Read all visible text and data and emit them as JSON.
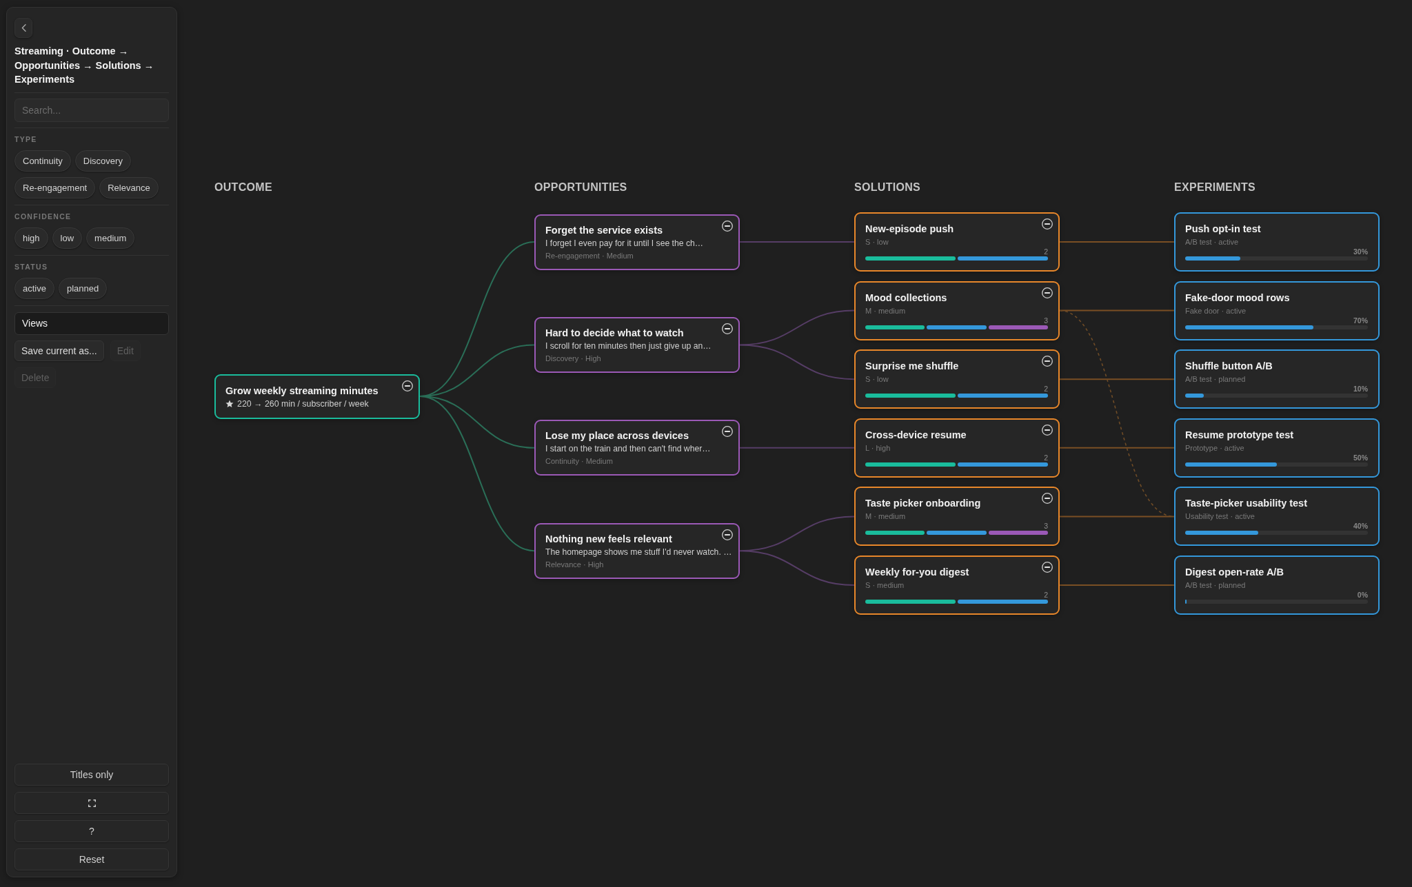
{
  "sidebar": {
    "title": "Streaming · Outcome → Opportunities → Solutions → Experiments",
    "search": {
      "placeholder": "Search..."
    },
    "filter_groups": [
      {
        "label": "TYPE",
        "chips": [
          {
            "label": "Continuity",
            "selected": false
          },
          {
            "label": "Discovery",
            "selected": false
          },
          {
            "label": "Re-engagement",
            "selected": false
          },
          {
            "label": "Relevance",
            "selected": false
          }
        ]
      },
      {
        "label": "CONFIDENCE",
        "chips": [
          {
            "label": "high",
            "selected": false
          },
          {
            "label": "low",
            "selected": false
          },
          {
            "label": "medium",
            "selected": false
          }
        ]
      },
      {
        "label": "STATUS",
        "chips": [
          {
            "label": "active",
            "selected": false
          },
          {
            "label": "planned",
            "selected": false
          }
        ]
      }
    ],
    "views": {
      "label": "Views"
    },
    "view_actions": [
      {
        "label": "Save current as...",
        "disabled": false
      },
      {
        "label": "Edit",
        "disabled": true
      },
      {
        "label": "Delete",
        "disabled": true
      }
    ],
    "bottom_buttons": [
      {
        "kind": "text",
        "label": "Titles only"
      },
      {
        "kind": "icon"
      },
      {
        "kind": "text",
        "label": "?"
      },
      {
        "kind": "text",
        "label": "Reset"
      }
    ]
  },
  "board": {
    "columns": [
      {
        "label": "OUTCOME"
      },
      {
        "label": "OPPORTUNITIES"
      },
      {
        "label": "SOLUTIONS"
      },
      {
        "label": "EXPERIMENTS"
      }
    ],
    "outcome": {
      "title": "Grow weekly streaming minutes",
      "metric": "220 → 260 min / subscriber / week",
      "expanded": true,
      "opportunities": [
        {
          "title": "Forget the service exists",
          "description": "I forget I even pay for it until I see the ch…",
          "meta": "Re-engagement · Medium",
          "expanded": true,
          "solutions": [
            {
              "title": "New-episode push",
              "meta": "S · low",
              "count": "2",
              "segments": [
                {
                  "color": "#1abc9c"
                },
                {
                  "color": "#3498db"
                }
              ],
              "expanded": true,
              "experiments": [
                {
                  "title": "Push opt-in test",
                  "meta": "A/B test · active",
                  "progress": "30%",
                  "level": 0.3
                }
              ]
            }
          ]
        },
        {
          "title": "Hard to decide what to watch",
          "description": "I scroll for ten minutes then just give up an…",
          "meta": "Discovery · High",
          "expanded": true,
          "solutions": [
            {
              "title": "Mood collections",
              "meta": "M · medium",
              "count": "3",
              "segments": [
                {
                  "color": "#1abc9c"
                },
                {
                  "color": "#3498db"
                },
                {
                  "color": "#9b59b6"
                }
              ],
              "expanded": true,
              "dashed_link_out": true,
              "experiments": [
                {
                  "title": "Fake-door mood rows",
                  "meta": "Fake door · active",
                  "progress": "70%",
                  "level": 0.7
                }
              ]
            },
            {
              "title": "Surprise me shuffle",
              "meta": "S · low",
              "count": "2",
              "segments": [
                {
                  "color": "#1abc9c"
                },
                {
                  "color": "#3498db"
                }
              ],
              "expanded": true,
              "experiments": [
                {
                  "title": "Shuffle button A/B",
                  "meta": "A/B test · planned",
                  "progress": "10%",
                  "level": 0.1
                }
              ]
            }
          ]
        },
        {
          "title": "Lose my place across devices",
          "description": "I start on the train and then can't find wher…",
          "meta": "Continuity · Medium",
          "expanded": true,
          "solutions": [
            {
              "title": "Cross-device resume",
              "meta": "L · high",
              "count": "2",
              "segments": [
                {
                  "color": "#1abc9c"
                },
                {
                  "color": "#3498db"
                }
              ],
              "expanded": true,
              "experiments": [
                {
                  "title": "Resume prototype test",
                  "meta": "Prototype · active",
                  "progress": "50%",
                  "level": 0.5
                }
              ]
            }
          ]
        },
        {
          "title": "Nothing new feels relevant",
          "description": "The homepage shows me stuff I'd never watch. …",
          "meta": "Relevance · High",
          "expanded": true,
          "solutions": [
            {
              "title": "Taste picker onboarding",
              "meta": "M · medium",
              "count": "3",
              "segments": [
                {
                  "color": "#1abc9c"
                },
                {
                  "color": "#3498db"
                },
                {
                  "color": "#9b59b6"
                }
              ],
              "expanded": true,
              "experiments": [
                {
                  "title": "Taste-picker usability test",
                  "meta": "Usability test · active",
                  "progress": "40%",
                  "level": 0.4,
                  "dashed_link_in": true
                }
              ]
            },
            {
              "title": "Weekly for-you digest",
              "meta": "S · medium",
              "count": "2",
              "segments": [
                {
                  "color": "#1abc9c"
                },
                {
                  "color": "#3498db"
                }
              ],
              "expanded": true,
              "experiments": [
                {
                  "title": "Digest open-rate A/B",
                  "meta": "A/B test · planned",
                  "progress": "0%",
                  "level": 0
                }
              ]
            }
          ]
        }
      ]
    }
  }
}
